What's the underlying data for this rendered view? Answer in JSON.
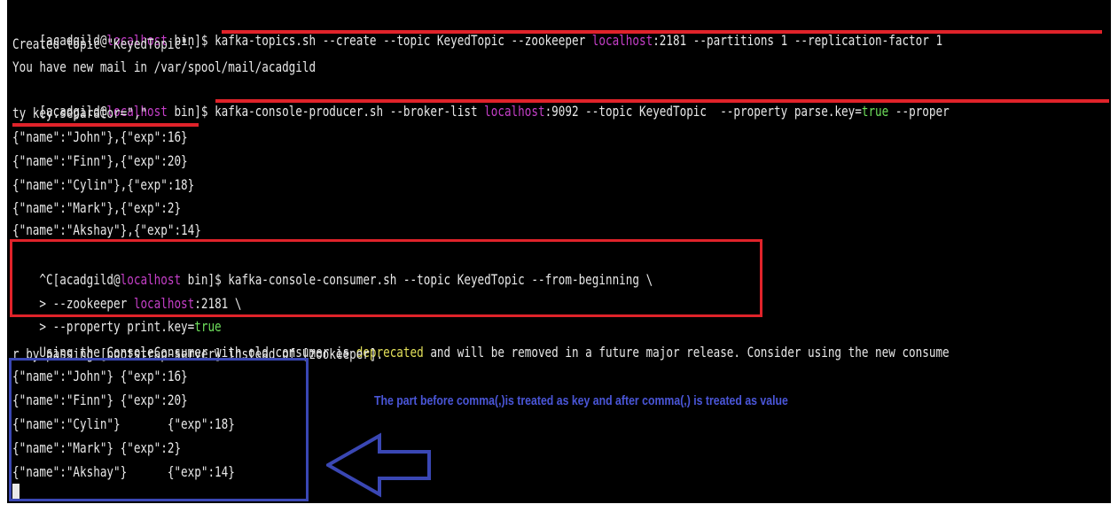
{
  "prompt": {
    "user": "[acadgild@",
    "host": "localhost",
    "dir": " bin]$ ",
    "ctrl_c": "^C"
  },
  "commands": {
    "create_topic_a": "kafka-topics.sh --create --topic KeyedTopic --zookeeper ",
    "create_topic_b": ":2181 --partitions 1 --replication-factor 1",
    "producer_a": "kafka-console-producer.sh --broker-list ",
    "producer_b": ":9092 --topic KeyedTopic  --property parse.key=",
    "producer_true": "true",
    "producer_c": " --proper",
    "producer_wrap": "ty key.separator=\",\"",
    "consumer_a": "kafka-console-consumer.sh --topic KeyedTopic --from-beginning \\",
    "consumer_zk_a": "> --zookeeper ",
    "consumer_zk_b": ":2181 \\",
    "consumer_prop_a": "> --property print.key=",
    "consumer_prop_true": "true"
  },
  "output": {
    "created": "Created topic \"KeyedTopic\".",
    "mail": "You have new mail in /var/spool/mail/acadgild",
    "warn_a": "Using the ConsoleConsumer with old consumer is ",
    "warn_word": "deprecated",
    "warn_b": " and will be removed in a future major release. Consider using the new consume",
    "warn_wrap": "r by passing [bootstrap-server] instead of [zookeeper]."
  },
  "producer_input": [
    "{\"name\":\"John\"},{\"exp\":16}",
    "{\"name\":\"Finn\"},{\"exp\":20}",
    "{\"name\":\"Cylin\"},{\"exp\":18}",
    "{\"name\":\"Mark\"},{\"exp\":2}",
    "{\"name\":\"Akshay\"},{\"exp\":14}"
  ],
  "consumer_output": [
    "{\"name\":\"John\"} {\"exp\":16}",
    "{\"name\":\"Finn\"} {\"exp\":20}",
    "{\"name\":\"Cylin\"}       {\"exp\":18}",
    "{\"name\":\"Mark\"} {\"exp\":2}",
    "{\"name\":\"Akshay\"}      {\"exp\":14}"
  ],
  "annotation": {
    "note": "The part before comma(,)is treated as key and after comma(,) is treated as value"
  },
  "colors": {
    "background": "#000000",
    "text": "#e8e8e8",
    "host": "#c53fc8",
    "bool": "#6ee05c",
    "warning_word": "#e3e05a",
    "highlight_red": "#e0232a",
    "highlight_blue": "#3a47b4"
  }
}
